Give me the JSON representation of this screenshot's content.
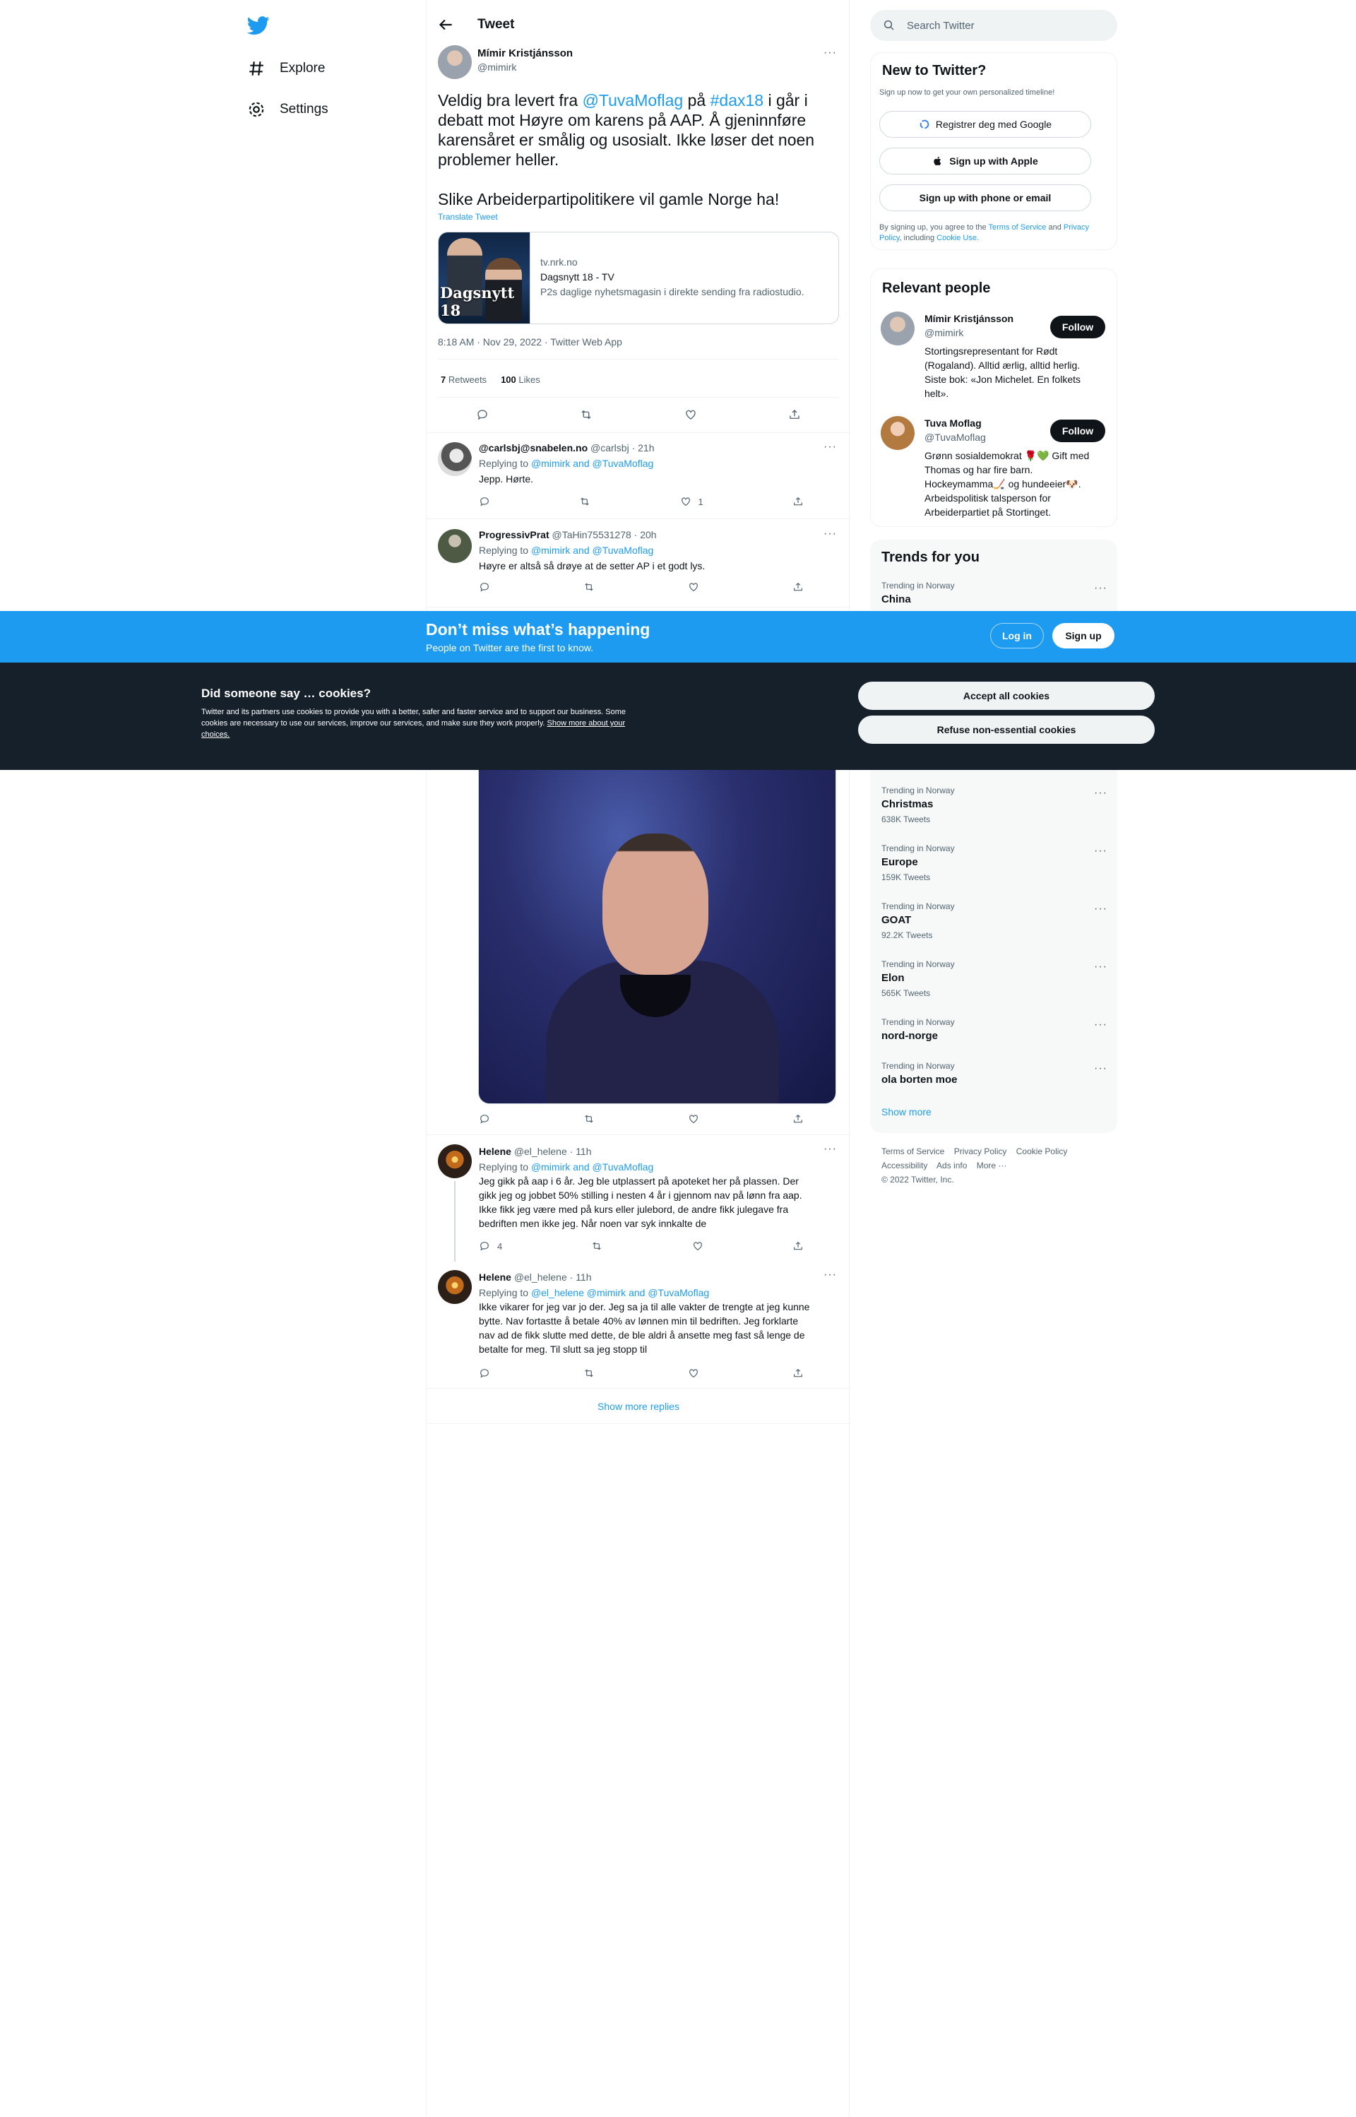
{
  "nav": {
    "explore": "Explore",
    "settings": "Settings"
  },
  "header": {
    "title": "Tweet"
  },
  "main_tweet": {
    "name": "Mímir Kristjánsson",
    "handle": "@mimirk",
    "text_part1": "Veldig bra levert fra ",
    "mention": "@TuvaMoflag",
    "text_part2": " på ",
    "hashtag": "#dax18",
    "text_part3": " i går i debatt mot Høyre om karens på AAP. Å gjeninnføre karensåret er smålig og usosialt. Ikke løser det noen problemer heller.",
    "text_para2": "Slike Arbeiderpartipolitikere vil gamle Norge ha!",
    "translate": "Translate Tweet",
    "card": {
      "image_label": "Dagsnytt 18",
      "domain": "tv.nrk.no",
      "title": "Dagsnytt 18 - TV",
      "description": "P2s daglige nyhetsmagasin i direkte sending fra radiostudio."
    },
    "meta": "8:18 AM · Nov 29, 2022 · Twitter Web App",
    "retweets_count": "7",
    "retweets_label": "Retweets",
    "likes_count": "100",
    "likes_label": "Likes"
  },
  "replies": [
    {
      "name": "@carlsbj@snabelen.no",
      "handle_time": "@carlsbj · 21h",
      "replying_prefix": "Replying to ",
      "replying_to": "@mimirk and @TuvaMoflag",
      "text": "Jepp. Hørte.",
      "like_count": "1"
    },
    {
      "name": "ProgressivPrat",
      "handle_time": "@TaHin75531278 · 20h",
      "replying_prefix": "Replying to ",
      "replying_to": "@mimirk and @TuvaMoflag",
      "text": "Høyre er altså så drøye at de setter AP i et godt lys."
    },
    {
      "name": "Helene",
      "handle_time": "@el_helene · 11h",
      "replying_prefix": "Replying to ",
      "replying_to": "@mimirk and @TuvaMoflag",
      "lines": [
        "Jeg gikk på aap i 6 år. Jeg ble utplassert på apoteket her på plassen. Der",
        "gikk jeg og jobbet 50% stilling i nesten 4 år i gjennom nav på lønn fra aap.",
        "Ikke fikk jeg være med på kurs eller julebord, de andre fikk julegave fra",
        "bedriften men ikke jeg. Når noen var syk innkalte de"
      ],
      "reply_count": "4"
    },
    {
      "name": "Helene",
      "handle_time": "@el_helene · 11h",
      "replying_prefix": "Replying to ",
      "replying_to": "@el_helene @mimirk and @TuvaMoflag",
      "lines": [
        "Ikke vikarer for jeg var jo der. Jeg sa ja til alle vakter de trengte at jeg kunne",
        "bytte. Nav fortastte å betale 40% av lønnen min til bedriften. Jeg forklarte",
        "nav ad de fikk slutte med dette, de ble aldri å ansette meg fast så lenge de",
        "betalte for meg. Til slutt sa jeg stopp til"
      ]
    }
  ],
  "show_more_replies": "Show more replies",
  "search": {
    "placeholder": "Search Twitter"
  },
  "new_to_twitter": {
    "title": "New to Twitter?",
    "subtitle": "Sign up now to get your own personalized timeline!",
    "google": "Registrer deg med Google",
    "apple": "Sign up with Apple",
    "phone": "Sign up with phone or email",
    "legal_prefix": "By signing up, you agree to the ",
    "terms": "Terms of Service",
    "legal_and": " and ",
    "privacy": "Privacy Policy",
    "legal_including": ", including ",
    "cookie_use": "Cookie Use."
  },
  "relevant_people": {
    "title": "Relevant people",
    "follow_label": "Follow",
    "people": [
      {
        "name": "Mímir Kristjánsson",
        "handle": "@mimirk",
        "bio_lines": [
          "Stortingsrepresentant for Rødt",
          "(Rogaland). Alltid ærlig, alltid herlig.",
          "Siste bok: «Jon Michelet. En folkets",
          "helt»."
        ]
      },
      {
        "name": "Tuva Moflag",
        "handle": "@TuvaMoflag",
        "bio_lines": [
          "Grønn sosialdemokrat 🌹💚 Gift med",
          "Thomas og har fire barn.",
          "Hockeymamma🏒 og hundeeier🐶.",
          "Arbeidspolitisk talsperson for",
          "Arbeiderpartiet på Stortinget."
        ]
      }
    ]
  },
  "trends": {
    "title": "Trends for you",
    "items": [
      {
        "location": "Trending in Norway",
        "name": "China",
        "count": ""
      },
      {
        "location": "Trending in Norway",
        "name": "Christmas",
        "count": "638K Tweets"
      },
      {
        "location": "Trending in Norway",
        "name": "Europe",
        "count": "159K Tweets"
      },
      {
        "location": "Trending in Norway",
        "name": "GOAT",
        "count": "92.2K Tweets"
      },
      {
        "location": "Trending in Norway",
        "name": "Elon",
        "count": "565K Tweets"
      },
      {
        "location": "Trending in Norway",
        "name": "nord-norge",
        "count": ""
      },
      {
        "location": "Trending in Norway",
        "name": "ola borten moe",
        "count": ""
      }
    ],
    "show_more": "Show more"
  },
  "footer": {
    "terms": "Terms of Service",
    "privacy": "Privacy Policy",
    "cookie": "Cookie Policy",
    "accessibility": "Accessibility",
    "ads": "Ads info",
    "more": "More ···",
    "copyright": "© 2022 Twitter, Inc."
  },
  "banner": {
    "title": "Don’t miss what’s happening",
    "subtitle": "People on Twitter are the first to know.",
    "login": "Log in",
    "signup": "Sign up"
  },
  "cookie_bar": {
    "title": "Did someone say … cookies?",
    "body": "Twitter and its partners use cookies to provide you with a better, safer and faster service and to support our business. Some cookies are necessary to use our services, improve our services, and make sure they work properly. ",
    "link": "Show more about your choices.",
    "accept": "Accept all cookies",
    "refuse": "Refuse non-essential cookies"
  },
  "colors": {
    "accent": "#1d9bf0",
    "banner": "#1d9bf0",
    "cookie_bg": "#15202b"
  }
}
